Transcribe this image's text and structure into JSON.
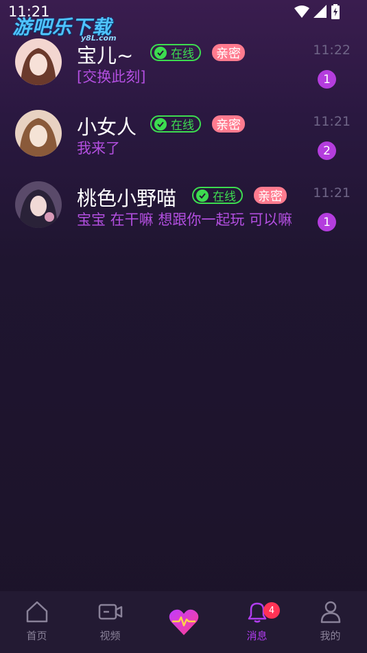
{
  "status_bar": {
    "time": "11:21"
  },
  "watermark": {
    "text": "游吧乐下载",
    "sub": "y8L.com"
  },
  "chats": [
    {
      "name": "宝儿~",
      "online_label": "在线",
      "intimate_label": "亲密",
      "preview": "[交换此刻]",
      "time": "11:22",
      "unread": "1",
      "avatar_colors": [
        "#f3d6d0",
        "#6b3a2c"
      ]
    },
    {
      "name": "小女人",
      "online_label": "在线",
      "intimate_label": "亲密",
      "preview": "我来了",
      "time": "11:21",
      "unread": "2",
      "avatar_colors": [
        "#e8d2c2",
        "#8a5a3a"
      ]
    },
    {
      "name": "桃色小野喵",
      "online_label": "在线",
      "intimate_label": "亲密",
      "preview": "宝宝 在干嘛 想跟你一起玩 可以嘛",
      "time": "11:21",
      "unread": "1",
      "avatar_colors": [
        "#5a4a6a",
        "#2a2238"
      ]
    }
  ],
  "tabbar": {
    "tabs": [
      {
        "label": "首页",
        "icon": "home-icon"
      },
      {
        "label": "视频",
        "icon": "video-icon"
      },
      {
        "label": "",
        "icon": "heart-pulse-icon"
      },
      {
        "label": "消息",
        "icon": "bell-icon",
        "badge": "4",
        "active": true
      },
      {
        "label": "我的",
        "icon": "user-icon"
      }
    ]
  },
  "colors": {
    "accent": "#b13df0",
    "online": "#3ddc50",
    "intimate": "#ff7b8f",
    "badge": "#ff3355"
  }
}
